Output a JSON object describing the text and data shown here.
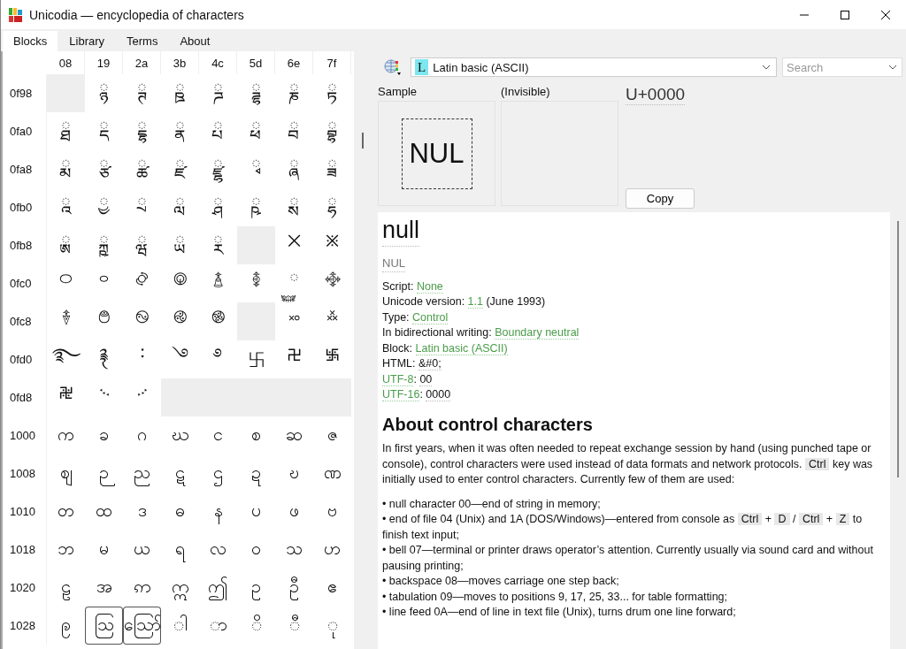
{
  "window": {
    "title": "Unicodia — encyclopedia of characters"
  },
  "tabs": [
    {
      "label": "Blocks",
      "selected": true
    },
    {
      "label": "Library",
      "selected": false
    },
    {
      "label": "Terms",
      "selected": false
    },
    {
      "label": "About",
      "selected": false
    }
  ],
  "grid": {
    "columns": [
      "08",
      "19",
      "2a",
      "3b",
      "4c",
      "5d",
      "6e",
      "7f"
    ],
    "rows": [
      {
        "label": "0f98",
        "cells": [
          {
            "kind": "empty"
          },
          {
            "kind": "glyph",
            "char": "◌ྙ"
          },
          {
            "kind": "glyph",
            "char": "◌ྚ"
          },
          {
            "kind": "glyph",
            "char": "◌ྛ"
          },
          {
            "kind": "glyph",
            "char": "◌ྜ"
          },
          {
            "kind": "glyph",
            "char": "◌ྜྷ"
          },
          {
            "kind": "glyph",
            "char": "◌ྞ"
          },
          {
            "kind": "glyph",
            "char": "◌ྟ"
          }
        ]
      },
      {
        "label": "0fa0",
        "cells": [
          {
            "kind": "glyph",
            "char": "◌ྠ"
          },
          {
            "kind": "glyph",
            "char": "◌ྡ"
          },
          {
            "kind": "glyph",
            "char": "◌ྡྷ"
          },
          {
            "kind": "glyph",
            "char": "◌ྣ"
          },
          {
            "kind": "glyph",
            "char": "◌ྤ"
          },
          {
            "kind": "glyph",
            "char": "◌ྥ"
          },
          {
            "kind": "glyph",
            "char": "◌ྦ"
          },
          {
            "kind": "glyph",
            "char": "◌ྦྷ"
          }
        ]
      },
      {
        "label": "0fa8",
        "cells": [
          {
            "kind": "glyph",
            "char": "◌ྨ"
          },
          {
            "kind": "glyph",
            "char": "◌ྩ"
          },
          {
            "kind": "glyph",
            "char": "◌ྪ"
          },
          {
            "kind": "glyph",
            "char": "◌ྫ"
          },
          {
            "kind": "glyph",
            "char": "◌ྫྷ"
          },
          {
            "kind": "glyph",
            "char": "◌ྭ"
          },
          {
            "kind": "glyph",
            "char": "◌ྮ"
          },
          {
            "kind": "glyph",
            "char": "◌ྯ"
          }
        ]
      },
      {
        "label": "0fb0",
        "cells": [
          {
            "kind": "glyph",
            "char": "◌ྰ"
          },
          {
            "kind": "glyph",
            "char": "◌ྱ"
          },
          {
            "kind": "glyph",
            "char": "◌ྲ"
          },
          {
            "kind": "glyph",
            "char": "◌ླ"
          },
          {
            "kind": "glyph",
            "char": "◌ྴ"
          },
          {
            "kind": "glyph",
            "char": "◌ྵ"
          },
          {
            "kind": "glyph",
            "char": "◌ྶ"
          },
          {
            "kind": "glyph",
            "char": "◌ྷ"
          }
        ]
      },
      {
        "label": "0fb8",
        "cells": [
          {
            "kind": "glyph",
            "char": "◌ྸ"
          },
          {
            "kind": "glyph",
            "char": "◌ྐྵ"
          },
          {
            "kind": "glyph",
            "char": "◌ྺ"
          },
          {
            "kind": "glyph",
            "char": "◌ྻ"
          },
          {
            "kind": "glyph",
            "char": "◌ྼ"
          },
          {
            "kind": "empty"
          },
          {
            "kind": "glyph",
            "char": "྾"
          },
          {
            "kind": "glyph",
            "char": "྿"
          }
        ]
      },
      {
        "label": "0fc0",
        "cells": [
          {
            "kind": "glyph",
            "char": "࿀"
          },
          {
            "kind": "glyph",
            "char": "࿁"
          },
          {
            "kind": "glyph",
            "char": "࿂"
          },
          {
            "kind": "glyph",
            "char": "࿃"
          },
          {
            "kind": "glyph",
            "char": "࿄"
          },
          {
            "kind": "glyph",
            "char": "࿅"
          },
          {
            "kind": "glyph",
            "char": "◌࿆"
          },
          {
            "kind": "glyph",
            "char": "࿇"
          }
        ]
      },
      {
        "label": "0fc8",
        "cells": [
          {
            "kind": "glyph",
            "char": "࿈"
          },
          {
            "kind": "glyph",
            "char": "࿉"
          },
          {
            "kind": "glyph",
            "char": "࿊"
          },
          {
            "kind": "glyph",
            "char": "࿋"
          },
          {
            "kind": "glyph",
            "char": "࿌"
          },
          {
            "kind": "empty"
          },
          {
            "kind": "glyph",
            "char": "࿎"
          },
          {
            "kind": "glyph",
            "char": "࿏"
          }
        ]
      },
      {
        "label": "0fd0",
        "cells": [
          {
            "kind": "glyph",
            "char": "࿐"
          },
          {
            "kind": "glyph",
            "char": "࿑"
          },
          {
            "kind": "glyph",
            "char": "࿒"
          },
          {
            "kind": "glyph",
            "char": "࿓"
          },
          {
            "kind": "glyph",
            "char": "࿔"
          },
          {
            "kind": "glyph",
            "char": "࿕"
          },
          {
            "kind": "glyph",
            "char": "࿖"
          },
          {
            "kind": "glyph",
            "char": "࿗"
          }
        ]
      },
      {
        "label": "0fd8",
        "cells": [
          {
            "kind": "glyph",
            "char": "࿘"
          },
          {
            "kind": "glyph",
            "char": "࿙"
          },
          {
            "kind": "glyph",
            "char": "࿚"
          },
          {
            "kind": "empty"
          },
          {
            "kind": "empty"
          },
          {
            "kind": "empty"
          },
          {
            "kind": "empty"
          },
          {
            "kind": "empty"
          }
        ]
      },
      {
        "label": "1000",
        "cells": [
          {
            "kind": "glyph",
            "char": "က"
          },
          {
            "kind": "glyph",
            "char": "ခ"
          },
          {
            "kind": "glyph",
            "char": "ဂ"
          },
          {
            "kind": "glyph",
            "char": "ဃ"
          },
          {
            "kind": "glyph",
            "char": "င"
          },
          {
            "kind": "glyph",
            "char": "စ"
          },
          {
            "kind": "glyph",
            "char": "ဆ"
          },
          {
            "kind": "glyph",
            "char": "ဇ"
          }
        ]
      },
      {
        "label": "1008",
        "cells": [
          {
            "kind": "glyph",
            "char": "ဈ"
          },
          {
            "kind": "glyph",
            "char": "ဉ"
          },
          {
            "kind": "glyph",
            "char": "ည"
          },
          {
            "kind": "glyph",
            "char": "ဋ"
          },
          {
            "kind": "glyph",
            "char": "ဌ"
          },
          {
            "kind": "glyph",
            "char": "ဍ"
          },
          {
            "kind": "glyph",
            "char": "ဎ"
          },
          {
            "kind": "glyph",
            "char": "ဏ"
          }
        ]
      },
      {
        "label": "1010",
        "cells": [
          {
            "kind": "glyph",
            "char": "တ"
          },
          {
            "kind": "glyph",
            "char": "ထ"
          },
          {
            "kind": "glyph",
            "char": "ဒ"
          },
          {
            "kind": "glyph",
            "char": "ဓ"
          },
          {
            "kind": "glyph",
            "char": "န"
          },
          {
            "kind": "glyph",
            "char": "ပ"
          },
          {
            "kind": "glyph",
            "char": "ဖ"
          },
          {
            "kind": "glyph",
            "char": "ဗ"
          }
        ]
      },
      {
        "label": "1018",
        "cells": [
          {
            "kind": "glyph",
            "char": "ဘ"
          },
          {
            "kind": "glyph",
            "char": "မ"
          },
          {
            "kind": "glyph",
            "char": "ယ"
          },
          {
            "kind": "glyph",
            "char": "ရ"
          },
          {
            "kind": "glyph",
            "char": "လ"
          },
          {
            "kind": "glyph",
            "char": "ဝ"
          },
          {
            "kind": "glyph",
            "char": "သ"
          },
          {
            "kind": "glyph",
            "char": "ဟ"
          }
        ]
      },
      {
        "label": "1020",
        "cells": [
          {
            "kind": "glyph",
            "char": "ဠ"
          },
          {
            "kind": "glyph",
            "char": "အ"
          },
          {
            "kind": "glyph",
            "char": "ဢ"
          },
          {
            "kind": "glyph",
            "char": "ဣ"
          },
          {
            "kind": "glyph",
            "char": "ဤ"
          },
          {
            "kind": "glyph",
            "char": "ဥ"
          },
          {
            "kind": "glyph",
            "char": "ဦ"
          },
          {
            "kind": "glyph",
            "char": "ဧ"
          }
        ]
      },
      {
        "label": "1028",
        "cells": [
          {
            "kind": "glyph",
            "char": "ဨ"
          },
          {
            "kind": "framed",
            "char": "ဩ"
          },
          {
            "kind": "framed",
            "char": "ဪ"
          },
          {
            "kind": "glyph",
            "char": "◌ါ"
          },
          {
            "kind": "glyph",
            "char": "◌ာ"
          },
          {
            "kind": "glyph",
            "char": "◌ိ"
          },
          {
            "kind": "glyph",
            "char": "◌ီ"
          },
          {
            "kind": "glyph",
            "char": "◌ု"
          }
        ]
      }
    ]
  },
  "toolbar": {
    "block": {
      "letter": "L",
      "label": "Latin basic (ASCII)"
    },
    "search": {
      "placeholder": "Search"
    }
  },
  "character": {
    "sample_label": "Sample",
    "sample": "NUL",
    "glyph_label": "(Invisible)",
    "code": "U+0000",
    "copy_button": "Copy"
  },
  "article": {
    "title": "null",
    "abbreviation": "NUL",
    "properties": [
      [
        {
          "kind": "text",
          "text": "Script: "
        },
        {
          "kind": "link",
          "text": "None"
        }
      ],
      [
        {
          "kind": "text",
          "text": "Unicode version: "
        },
        {
          "kind": "link",
          "text": "1.1"
        },
        {
          "kind": "text",
          "text": " (June 1993)"
        }
      ],
      [
        {
          "kind": "text",
          "text": "Type: "
        },
        {
          "kind": "link",
          "text": "Control"
        }
      ],
      [
        {
          "kind": "text",
          "text": "In bidirectional writing: "
        },
        {
          "kind": "link",
          "text": "Boundary neutral"
        }
      ],
      [
        {
          "kind": "text",
          "text": "Block: "
        },
        {
          "kind": "link",
          "text": "Latin basic (ASCII)"
        }
      ],
      [
        {
          "kind": "text",
          "text": "HTML: "
        },
        {
          "kind": "code",
          "text": "&#0;"
        }
      ],
      [
        {
          "kind": "link",
          "text": "UTF-8"
        },
        {
          "kind": "text",
          "text": ": "
        },
        {
          "kind": "code",
          "text": "00"
        }
      ],
      [
        {
          "kind": "link",
          "text": "UTF-16"
        },
        {
          "kind": "text",
          "text": ": "
        },
        {
          "kind": "code",
          "text": "0000"
        }
      ]
    ],
    "heading": "About control characters",
    "paragraph": [
      {
        "kind": "text",
        "text": "In first years, when it was often needed to repeat exchange session by hand (using punched tape or console), control characters were used instead of data formats and network protocols. "
      },
      {
        "kind": "key",
        "text": "Ctrl"
      },
      {
        "kind": "text",
        "text": " key was initially used to enter control characters. Currently few of them are used:"
      }
    ],
    "bullets": [
      [
        {
          "kind": "text",
          "text": "• null character 00—end of string in memory;"
        }
      ],
      [
        {
          "kind": "text",
          "text": "• end of file 04 (Unix) and 1A (DOS/Windows)—entered from console as "
        },
        {
          "kind": "key",
          "text": "Ctrl"
        },
        {
          "kind": "text",
          "text": " + "
        },
        {
          "kind": "key",
          "text": "D"
        },
        {
          "kind": "text",
          "text": " / "
        },
        {
          "kind": "key",
          "text": "Ctrl"
        },
        {
          "kind": "text",
          "text": " + "
        },
        {
          "kind": "key",
          "text": "Z"
        },
        {
          "kind": "text",
          "text": " to finish text input;"
        }
      ],
      [
        {
          "kind": "text",
          "text": "• bell 07—terminal or printer draws operator’s attention. Currently usually via sound card and without pausing printing;"
        }
      ],
      [
        {
          "kind": "text",
          "text": "• backspace 08—moves carriage one step back;"
        }
      ],
      [
        {
          "kind": "text",
          "text": "• tabulation 09—moves to positions 9, 17, 25, 33... for table formatting;"
        }
      ],
      [
        {
          "kind": "text",
          "text": "• line feed 0A—end of line in text file (Unix), turns drum one line forward;"
        }
      ]
    ]
  }
}
